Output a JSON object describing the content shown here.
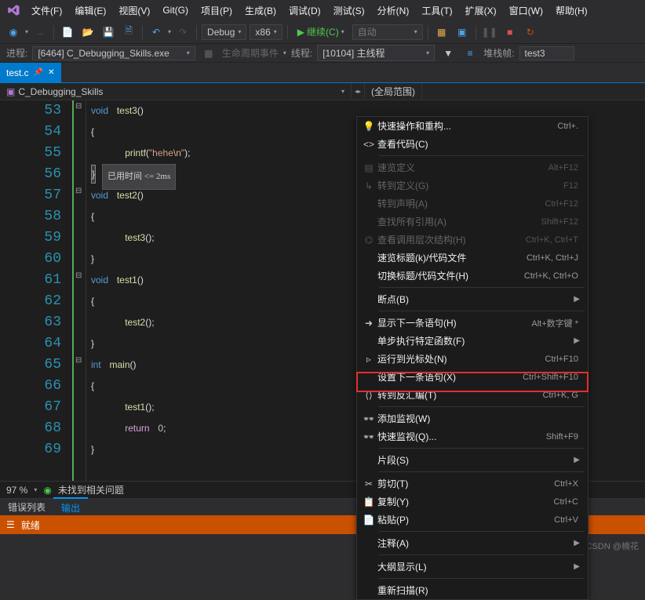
{
  "menubar": [
    "文件(F)",
    "编辑(E)",
    "视图(V)",
    "Git(G)",
    "项目(P)",
    "生成(B)",
    "调试(D)",
    "测试(S)",
    "分析(N)",
    "工具(T)",
    "扩展(X)",
    "窗口(W)",
    "帮助(H)"
  ],
  "toolbar": {
    "config": "Debug",
    "platform": "x86",
    "debug_btn": "继续(C)",
    "auto": "自动"
  },
  "infobar": {
    "process_lbl": "进程:",
    "process_val": "[6464] C_Debugging_Skills.exe",
    "lifecycle": "生命周期事件",
    "thread_lbl": "线程:",
    "thread_val": "[10104] 主线程",
    "stack_lbl": "堆栈帧:",
    "stack_val": "test3"
  },
  "tab": {
    "name": "test.c"
  },
  "nav": {
    "left": "C_Debugging_Skills",
    "right": "(全局范围)"
  },
  "code": {
    "lines": [
      53,
      54,
      55,
      56,
      57,
      58,
      59,
      60,
      61,
      62,
      63,
      64,
      65,
      66,
      67,
      68,
      69
    ],
    "tooltip": "已用时间 <= 2ms"
  },
  "bottombar": {
    "zoom": "97 %",
    "issues": "未找到相关问题"
  },
  "bottom_tabs": {
    "errors": "错误列表",
    "output": "输出"
  },
  "statusbar": {
    "ready": "就绪"
  },
  "watermark": "CSDN @楠花",
  "context_menu": {
    "items": [
      {
        "icon": "bulb",
        "label": "快速操作和重构...",
        "shortcut": "Ctrl+.",
        "enabled": true
      },
      {
        "icon": "code",
        "label": "查看代码(C)",
        "enabled": true
      },
      {
        "sep": true
      },
      {
        "icon": "peek",
        "label": "速览定义",
        "shortcut": "Alt+F12",
        "enabled": false
      },
      {
        "icon": "goto",
        "label": "转到定义(G)",
        "shortcut": "F12",
        "enabled": false
      },
      {
        "icon": "",
        "label": "转到声明(A)",
        "shortcut": "Ctrl+F12",
        "enabled": false
      },
      {
        "icon": "",
        "label": "查找所有引用(A)",
        "shortcut": "Shift+F12",
        "enabled": false
      },
      {
        "icon": "hier",
        "label": "查看调用层次结构(H)",
        "shortcut": "Ctrl+K, Ctrl+T",
        "enabled": false
      },
      {
        "icon": "",
        "label": "速览标题(k)/代码文件",
        "shortcut": "Ctrl+K, Ctrl+J",
        "enabled": true
      },
      {
        "icon": "",
        "label": "切换标题/代码文件(H)",
        "shortcut": "Ctrl+K, Ctrl+O",
        "enabled": true
      },
      {
        "sep": true
      },
      {
        "icon": "",
        "label": "断点(B)",
        "sub": true,
        "enabled": true
      },
      {
        "sep": true
      },
      {
        "icon": "next",
        "label": "显示下一条语句(H)",
        "shortcut": "Alt+数字键 *",
        "enabled": true
      },
      {
        "icon": "",
        "label": "单步执行特定函数(F)",
        "sub": true,
        "enabled": true
      },
      {
        "icon": "cursor",
        "label": "运行到光标处(N)",
        "shortcut": "Ctrl+F10",
        "enabled": true
      },
      {
        "icon": "",
        "label": "设置下一条语句(X)",
        "shortcut": "Ctrl+Shift+F10",
        "enabled": true
      },
      {
        "icon": "asm",
        "label": "转到反汇编(T)",
        "shortcut": "Ctrl+K, G",
        "enabled": true,
        "highlight": true
      },
      {
        "sep": true
      },
      {
        "icon": "watch",
        "label": "添加监视(W)",
        "enabled": true
      },
      {
        "icon": "qwatch",
        "label": "快速监视(Q)...",
        "shortcut": "Shift+F9",
        "enabled": true
      },
      {
        "sep": true
      },
      {
        "icon": "",
        "label": "片段(S)",
        "sub": true,
        "enabled": true
      },
      {
        "sep": true
      },
      {
        "icon": "cut",
        "label": "剪切(T)",
        "shortcut": "Ctrl+X",
        "enabled": true
      },
      {
        "icon": "copy",
        "label": "复制(Y)",
        "shortcut": "Ctrl+C",
        "enabled": true
      },
      {
        "icon": "paste",
        "label": "粘贴(P)",
        "shortcut": "Ctrl+V",
        "enabled": true
      },
      {
        "sep": true
      },
      {
        "icon": "",
        "label": "注释(A)",
        "sub": true,
        "enabled": true
      },
      {
        "sep": true
      },
      {
        "icon": "",
        "label": "大纲显示(L)",
        "sub": true,
        "enabled": true
      },
      {
        "sep": true
      },
      {
        "icon": "",
        "label": "重新扫描(R)",
        "enabled": true
      }
    ]
  }
}
